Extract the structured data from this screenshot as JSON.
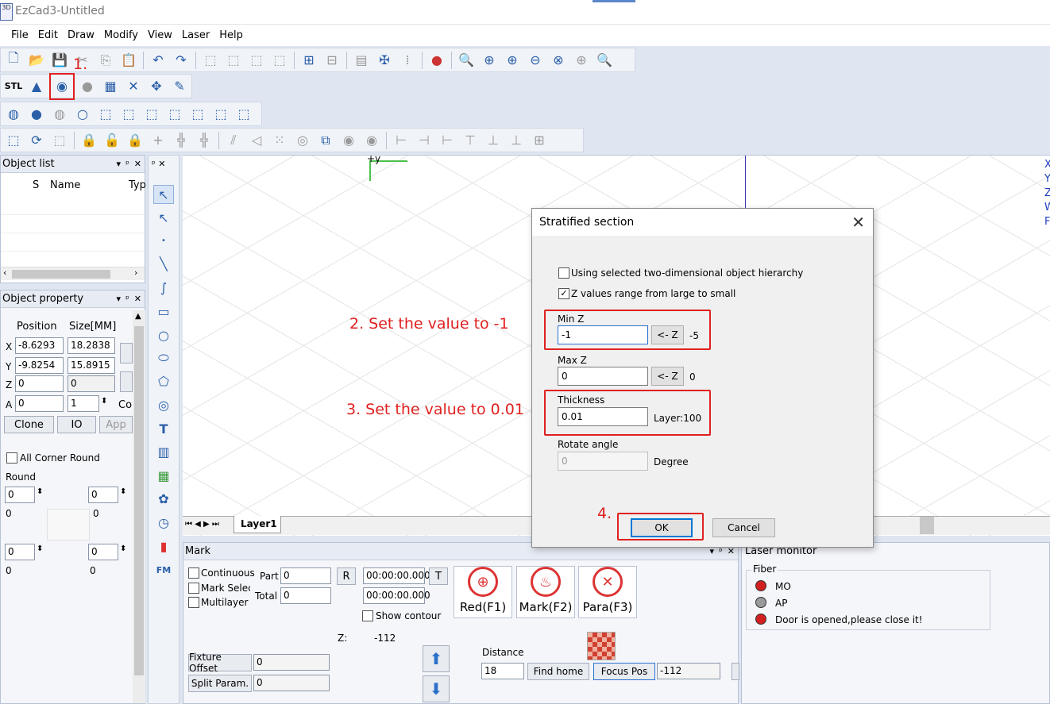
{
  "window": {
    "title": "EzCad3-Untitled",
    "logo_text": "3D"
  },
  "menu": [
    "File",
    "Edit",
    "Draw",
    "Modify",
    "View",
    "Laser",
    "Help"
  ],
  "toolbar2": {
    "stl_label": "STL"
  },
  "object_list": {
    "title": "Object list",
    "columns": [
      "S",
      "Name",
      "Typ"
    ]
  },
  "object_property": {
    "title": "Object property",
    "position_label": "Position",
    "size_label": "Size[MM]",
    "x_label": "X",
    "y_label": "Y",
    "z_label": "Z",
    "a_label": "A",
    "pos_x": "-8.6293",
    "size_x": "18.2838",
    "pos_y": "-9.8254",
    "size_y": "15.8915",
    "pos_z": "0",
    "size_z": "0",
    "pos_a": "0",
    "size_a": "1",
    "co_label": "Co",
    "clone": "Clone",
    "io": "IO",
    "app": "App",
    "all_corner_round": "All Corner Round",
    "round_label": "Round",
    "round_values": [
      "0",
      "0",
      "0",
      "0",
      "0",
      "0",
      "0",
      "0"
    ]
  },
  "canvas": {
    "axis_label": "+y",
    "right_labels": [
      "X",
      "Y",
      "Z",
      "W",
      "F"
    ]
  },
  "layer_tab": "Layer1",
  "mark_panel": {
    "title": "Mark",
    "continuous": "Continuous",
    "mark_select": "Mark Select",
    "multilayer": "Multilayer",
    "part_label": "Part",
    "part_value": "0",
    "total_label": "Total",
    "total_value": "0",
    "r_button": "R",
    "t_button": "T",
    "time1": "00:00:00.000",
    "time2": "00:00:00.000",
    "show_contour": "Show contour",
    "red": "Red(F1)",
    "mark": "Mark(F2)",
    "para": "Para(F3)",
    "z_label": "Z:",
    "z_value": "-112",
    "fixture_offset": "Fixture Offset",
    "fixture_value": "0",
    "split_param": "Split Param.",
    "split_value": "0",
    "distance_label": "Distance",
    "distance_value": "18",
    "find_home": "Find home",
    "focus_pos": "Focus Pos",
    "focus_value": "-112"
  },
  "laser_monitor": {
    "title": "Laser monitor",
    "group": "Fiber",
    "items": [
      "MO",
      "AP",
      "Door is opened,please close it!"
    ],
    "colors": [
      "#d22020",
      "#9a9a9a",
      "#d22020"
    ]
  },
  "dialog": {
    "title": "Stratified section",
    "close": "✕",
    "opt1": "Using selected two-dimensional object hierarchy",
    "opt2": "Z values range from large to small",
    "opt2_check": "✓",
    "min_z_label": "Min Z",
    "min_z_value": "-1",
    "min_z_btn": "<- Z",
    "min_z_ref": "-5",
    "max_z_label": "Max Z",
    "max_z_value": "0",
    "max_z_btn": "<- Z",
    "max_z_ref": "0",
    "thickness_label": "Thickness",
    "thickness_value": "0.01",
    "layer_info": "Layer:100",
    "rotate_label": "Rotate angle",
    "rotate_value": "0",
    "degree": "Degree",
    "ok": "OK",
    "cancel": "Cancel"
  },
  "annotations": {
    "step1": "1.",
    "step2": "2. Set the value to -1",
    "step3": "3. Set the value to 0.01",
    "step4": "4."
  }
}
